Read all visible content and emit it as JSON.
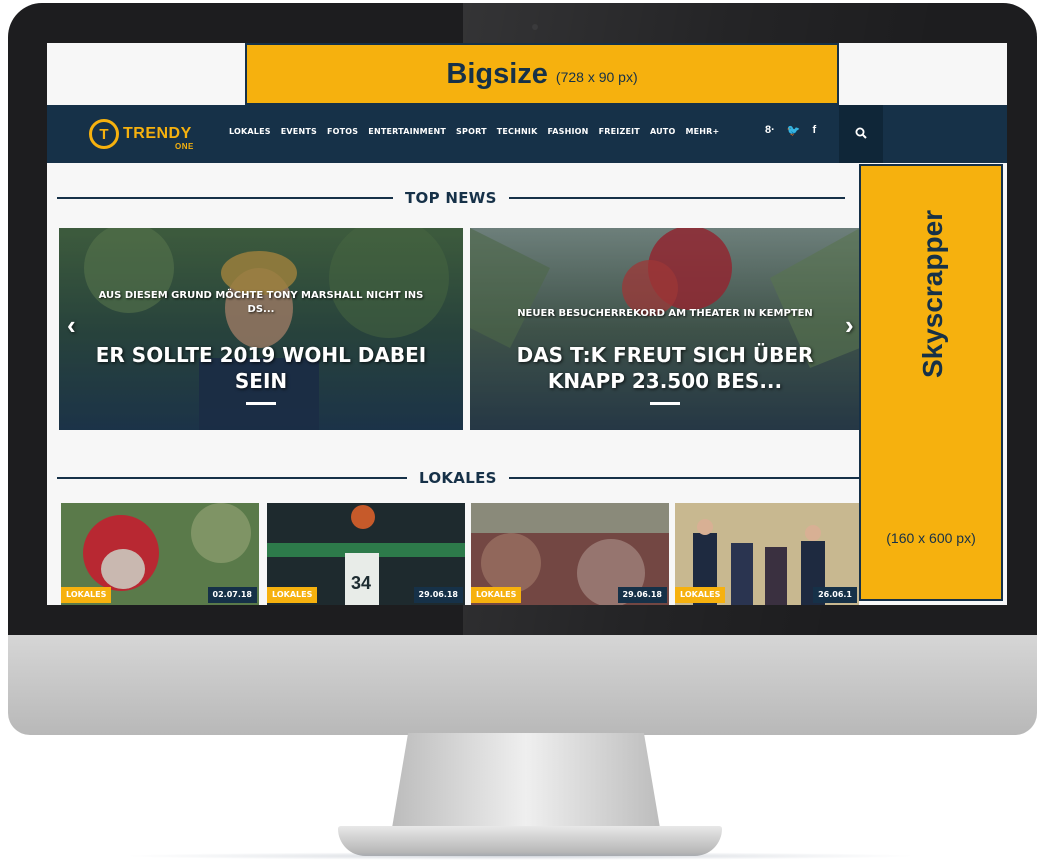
{
  "ad_top": {
    "title": "Bigsize",
    "size": "(728 x 90 px)"
  },
  "ad_side": {
    "title": "Skyscrapper",
    "size": "(160 x 600 px)"
  },
  "logo": {
    "mark": "T",
    "name": "TRENDY",
    "sub": "ONE"
  },
  "nav": {
    "items": [
      "LOKALES",
      "EVENTS",
      "FOTOS",
      "ENTERTAINMENT",
      "SPORT",
      "TECHNIK",
      "FASHION",
      "FREIZEIT",
      "AUTO",
      "MEHR+"
    ],
    "social": [
      "g+",
      "twitter",
      "facebook"
    ],
    "social_glyphs": [
      "8·",
      "🐦",
      "f"
    ],
    "search_icon": "search-icon"
  },
  "sections": {
    "top_news": "TOP NEWS",
    "lokales": "LOKALES"
  },
  "slides": [
    {
      "kicker": "AUS DIESEM GRUND MÖCHTE TONY MARSHALL NICHT INS",
      "kicker2": "DS...",
      "title_line1": "ER SOLLTE 2019 WOHL DABEI",
      "title_line2": "SEIN"
    },
    {
      "kicker": "NEUER BESUCHERREKORD AM THEATER IN KEMPTEN",
      "title_line1": "DAS T:K FREUT SICH ÜBER",
      "title_line2": "KNAPP 23.500 BES..."
    }
  ],
  "cards": [
    {
      "tag": "LOKALES",
      "date": "02.07.18"
    },
    {
      "tag": "LOKALES",
      "date": "29.06.18"
    },
    {
      "tag": "LOKALES",
      "date": "29.06.18"
    },
    {
      "tag": "LOKALES",
      "date": "26.06.1"
    }
  ],
  "colors": {
    "accent": "#f6b10e",
    "navy": "#163148"
  }
}
